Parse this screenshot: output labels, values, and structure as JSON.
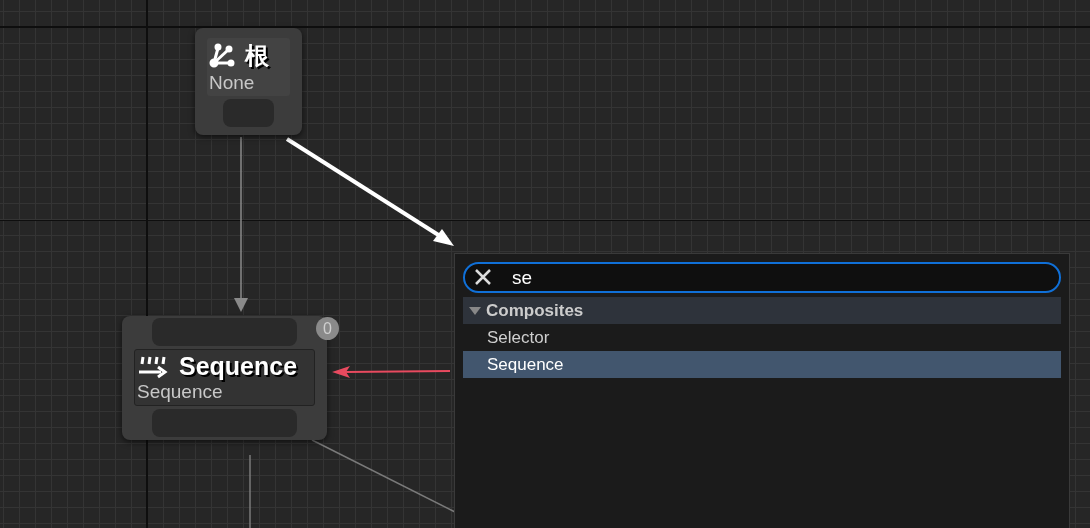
{
  "root_node": {
    "title": "根",
    "subtitle": "None"
  },
  "sequence_node": {
    "title": "Sequence",
    "subtitle": "Sequence",
    "badge": "0"
  },
  "search_popup": {
    "search": {
      "value": "se"
    },
    "categories": [
      {
        "label": "Composites",
        "expanded": true,
        "items": [
          {
            "label": "Selector",
            "selected": false
          },
          {
            "label": "Sequence",
            "selected": true
          }
        ]
      }
    ]
  }
}
